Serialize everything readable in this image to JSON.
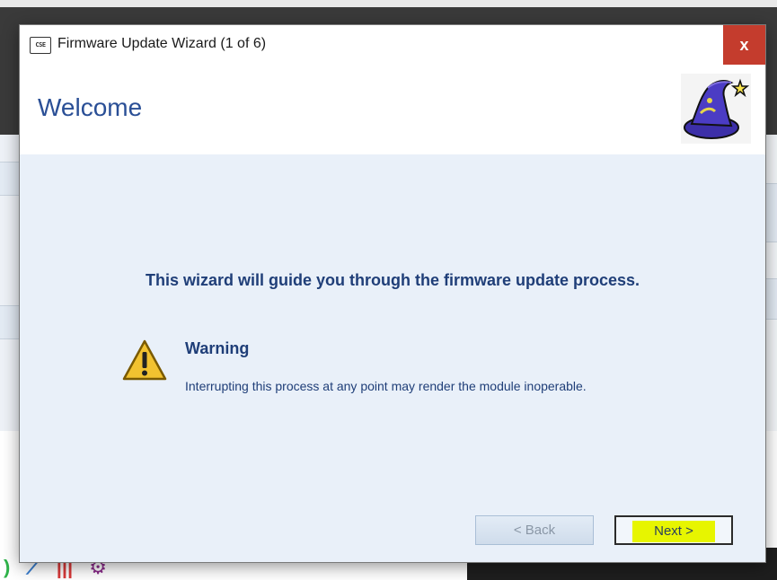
{
  "dialog": {
    "title": "Firmware Update Wizard (1 of 6)",
    "app_icon_label": "CSE",
    "close_label": "x",
    "header_title": "Welcome",
    "header_icon": "wizard-hat-icon",
    "intro": "This wizard will guide you through the firmware update process.",
    "warning": {
      "icon": "warning-triangle-icon",
      "title": "Warning",
      "text": "Interrupting this process at any point may render the module inoperable."
    },
    "buttons": {
      "back_label": "< Back",
      "back_enabled": false,
      "next_label": "Next >"
    }
  },
  "colors": {
    "header_title": "#2a4f96",
    "body_text": "#1f3e78",
    "content_bg": "#e9f0f9",
    "close_button": "#c43c2d",
    "next_highlight": "#e7f500"
  }
}
